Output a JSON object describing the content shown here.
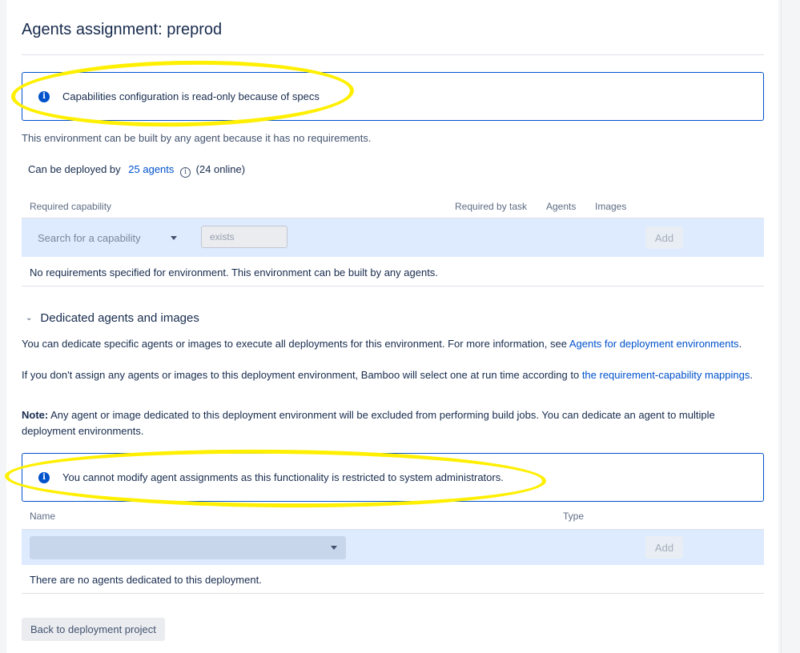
{
  "page": {
    "title": "Agents assignment: preprod"
  },
  "notices": {
    "capabilities_readonly": "Capabilities configuration is read-only because of specs",
    "cannot_modify": "You cannot modify agent assignments as this functionality is restricted to system administrators."
  },
  "requirements": {
    "intro": "This environment can be built by any agent because it has no requirements.",
    "deployed_by_prefix": "Can be deployed by",
    "agents_link": "25 agents",
    "online": "(24 online)",
    "columns": {
      "required_capability": "Required capability",
      "required_by_task": "Required by task",
      "agents": "Agents",
      "images": "Images"
    },
    "search_placeholder": "Search for a capability",
    "exists_placeholder": "exists",
    "add_label": "Add",
    "empty_message": "No requirements specified for environment. This environment can be built by any agents."
  },
  "dedicated": {
    "heading": "Dedicated agents and images",
    "para1_text": "You can dedicate specific agents or images to execute all deployments for this environment. For more information, see ",
    "para1_link": "Agents for deployment environments",
    "para1_end": ".",
    "para2_text": "If you don't assign any agents or images to this deployment environment, Bamboo will select one at run time according to ",
    "para2_link": "the requirement-capability mappings",
    "para2_end": ".",
    "note_label": "Note:",
    "note_text": " Any agent or image dedicated to this deployment environment will be excluded from performing build jobs. You can dedicate an agent to multiple deployment environments.",
    "columns": {
      "name": "Name",
      "type": "Type"
    },
    "add_label": "Add",
    "empty_message": "There are no agents dedicated to this deployment."
  },
  "footer": {
    "back_label": "Back to deployment project"
  },
  "colors": {
    "accent": "#0052cc",
    "row_bg": "#deebff",
    "highlight": "#ffef00"
  }
}
